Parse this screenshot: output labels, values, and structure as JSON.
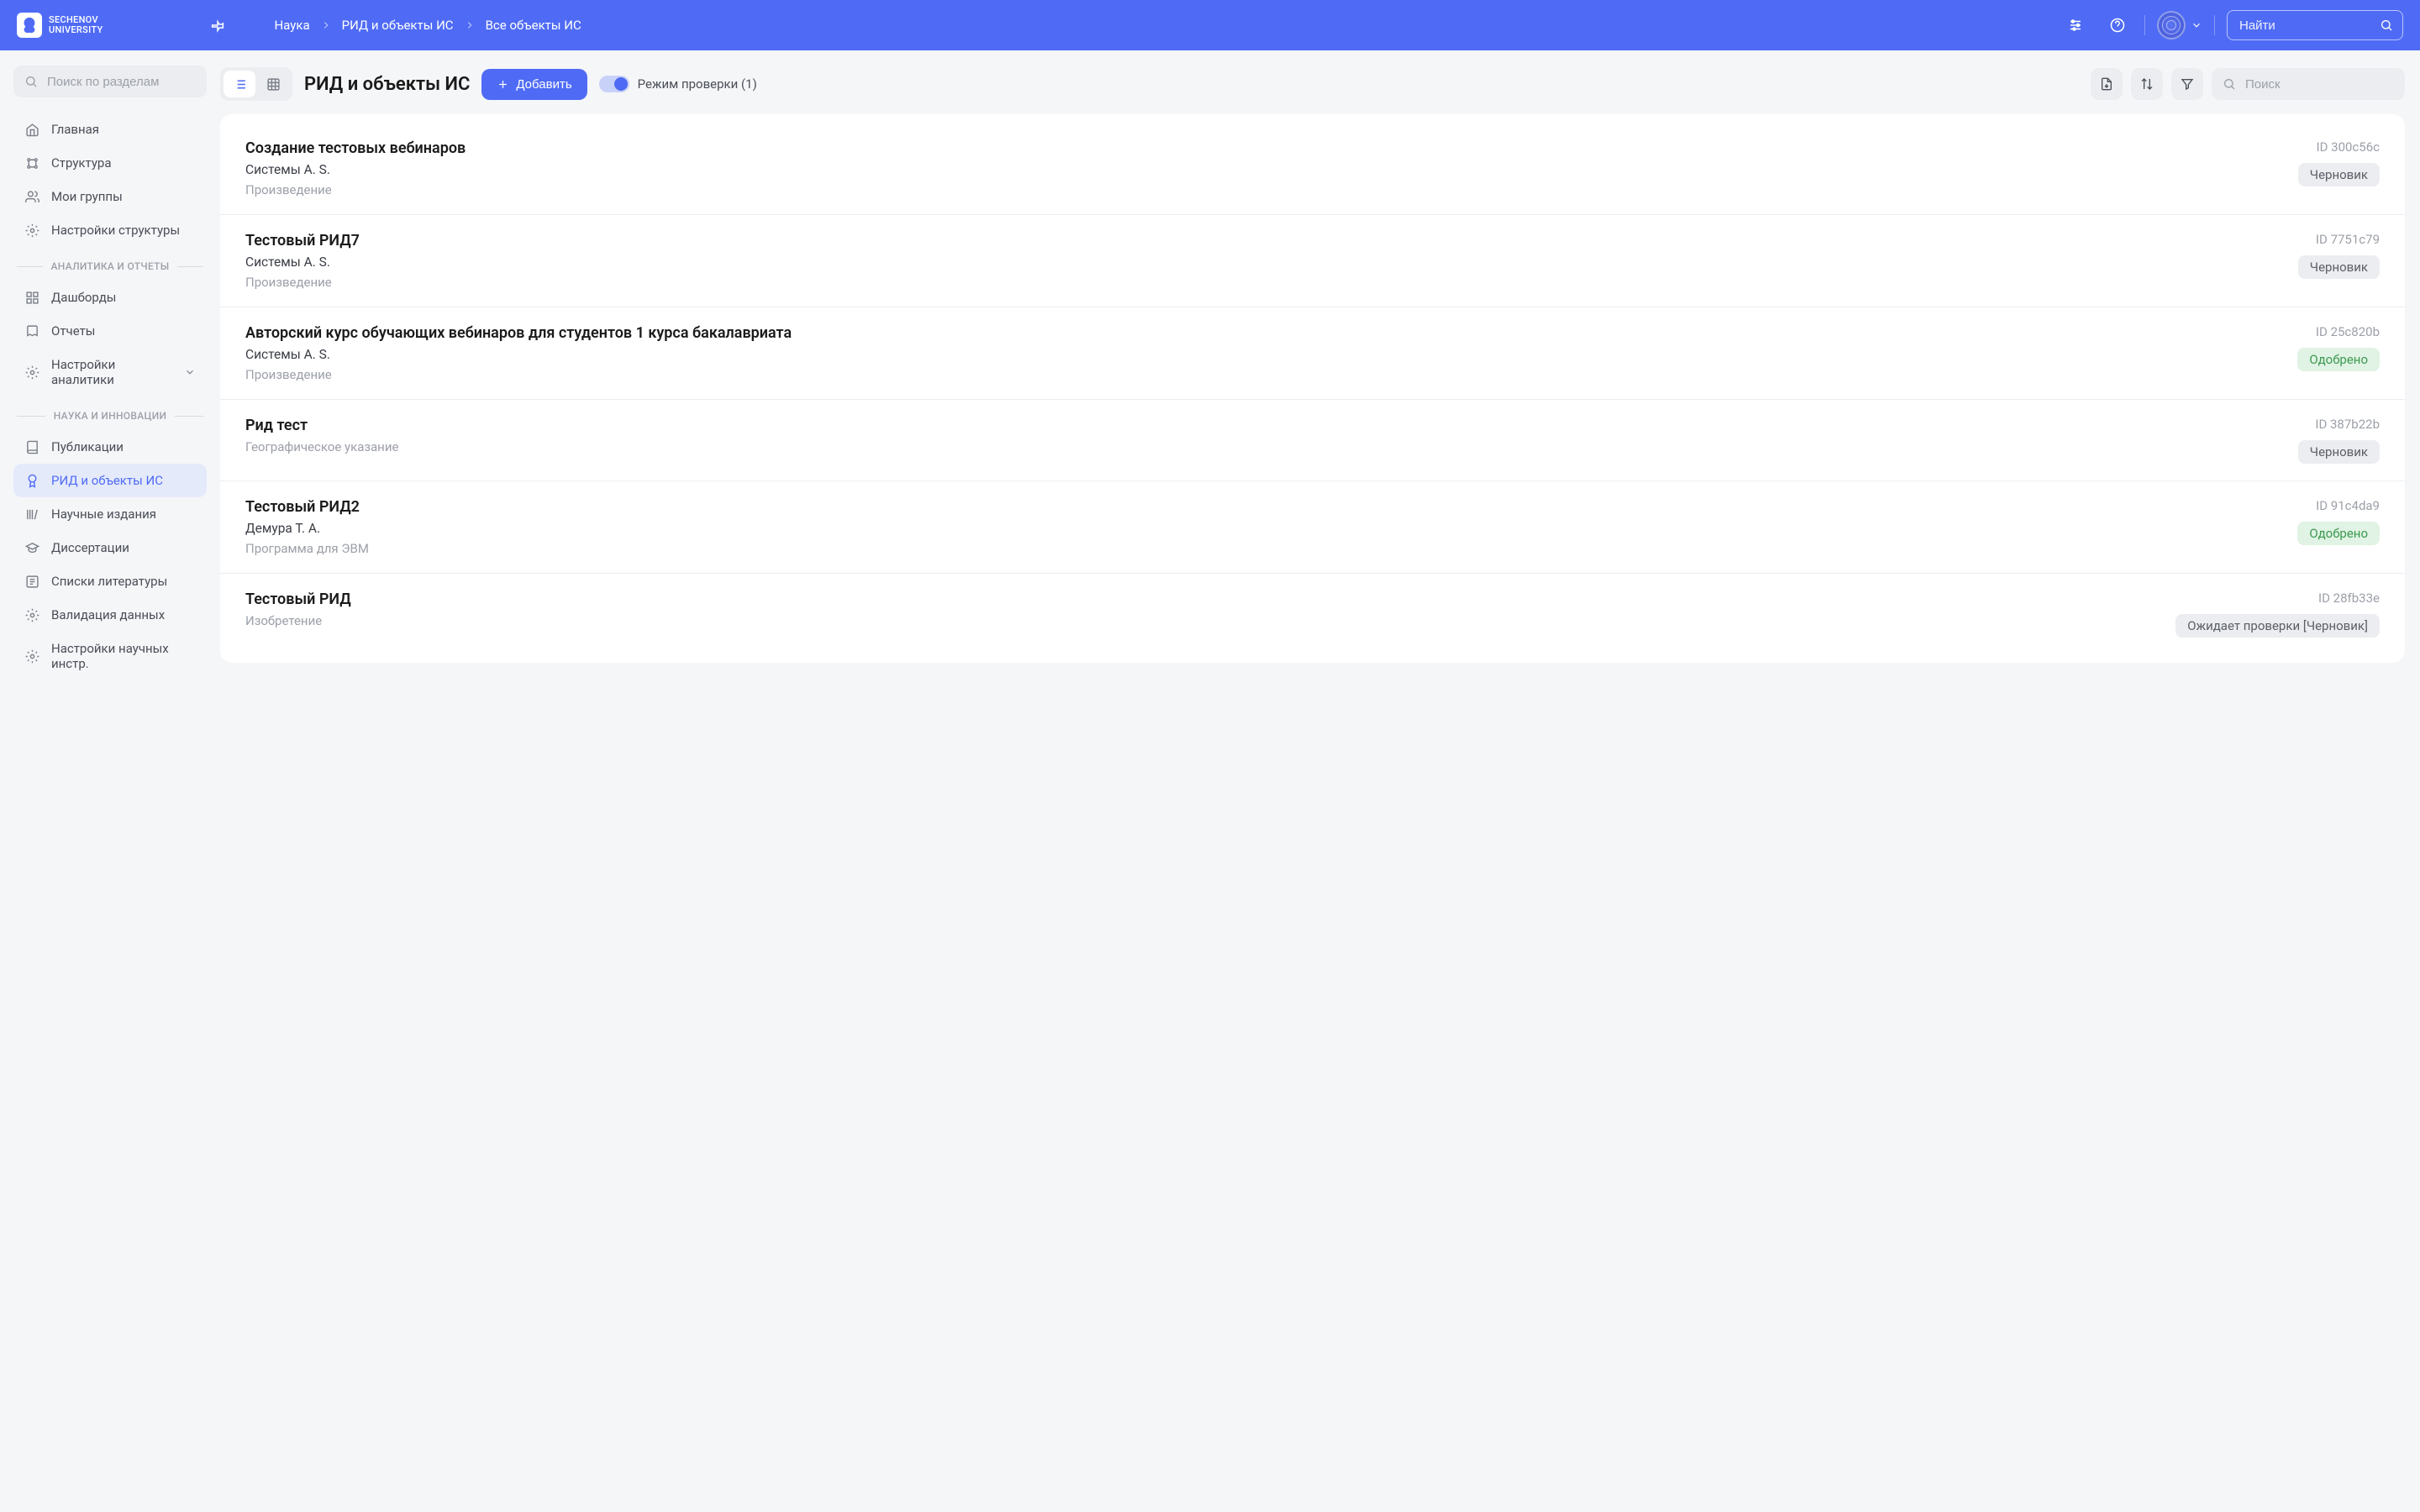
{
  "brand": {
    "line1": "SECHENOV",
    "line2": "UNIVERSITY"
  },
  "breadcrumb": {
    "a": "Наука",
    "b": "РИД и объекты ИС",
    "c": "Все объекты ИС"
  },
  "global_search_placeholder": "Найти",
  "side_search_placeholder": "Поиск по разделам",
  "sidebar": {
    "main": [
      {
        "label": "Главная"
      },
      {
        "label": "Структура"
      },
      {
        "label": "Мои группы"
      },
      {
        "label": "Настройки структуры"
      }
    ],
    "section_analytics": "АНАЛИТИКА И ОТЧЕТЫ",
    "analytics": [
      {
        "label": "Дашборды"
      },
      {
        "label": "Отчеты"
      },
      {
        "label": "Настройки аналитики"
      }
    ],
    "section_science": "НАУКА И ИННОВАЦИИ",
    "science": [
      {
        "label": "Публикации"
      },
      {
        "label": "РИД и объекты ИС"
      },
      {
        "label": "Научные издания"
      },
      {
        "label": "Диссертации"
      },
      {
        "label": "Списки литературы"
      },
      {
        "label": "Валидация данных"
      },
      {
        "label": "Настройки научных инстр."
      }
    ]
  },
  "page": {
    "title": "РИД и объекты ИС",
    "add_label": "Добавить",
    "review_mode_label": "Режим проверки (1)",
    "list_search_placeholder": "Поиск"
  },
  "items": [
    {
      "title": "Создание тестовых вебинаров",
      "author": "Системы A. S.",
      "type": "Произведение",
      "id": "ID 300c56c",
      "status": "Черновик",
      "status_kind": "draft"
    },
    {
      "title": "Тестовый РИД7",
      "author": "Системы A. S.",
      "type": "Произведение",
      "id": "ID 7751c79",
      "status": "Черновик",
      "status_kind": "draft"
    },
    {
      "title": "Авторский курс обучающих вебинаров для студентов 1 курса бакалавриата",
      "author": "Системы A. S.",
      "type": "Произведение",
      "id": "ID 25c820b",
      "status": "Одобрено",
      "status_kind": "approved"
    },
    {
      "title": "Рид тест",
      "author": "",
      "type": "Географическое указание",
      "id": "ID 387b22b",
      "status": "Черновик",
      "status_kind": "draft"
    },
    {
      "title": "Тестовый РИД2",
      "author": "Демура Т. А.",
      "type": "Программа для ЭВМ",
      "id": "ID 91c4da9",
      "status": "Одобрено",
      "status_kind": "approved"
    },
    {
      "title": "Тестовый РИД",
      "author": "",
      "type": "Изобретение",
      "id": "ID 28fb33e",
      "status": "Ожидает проверки [Черновик]",
      "status_kind": "pending"
    }
  ]
}
